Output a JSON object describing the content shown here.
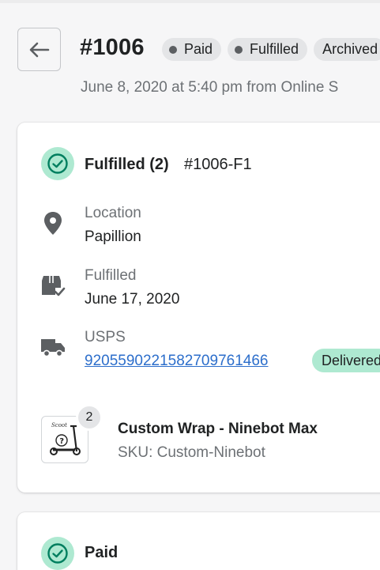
{
  "header": {
    "order_number": "#1006",
    "badges": [
      {
        "label": "Paid",
        "dot": true
      },
      {
        "label": "Fulfilled",
        "dot": true
      },
      {
        "label": "Archived",
        "dot": false
      }
    ],
    "subline": "June 8, 2020 at 5:40 pm from Online S"
  },
  "fulfillment": {
    "title": "Fulfilled (2)",
    "reference": "#1006-F1",
    "location_label": "Location",
    "location_value": "Papillion",
    "fulfilled_label": "Fulfilled",
    "fulfilled_value": "June 17, 2020",
    "carrier_label": "USPS",
    "tracking_number": "9205590221582709761466",
    "tracking_status": "Delivered",
    "item": {
      "quantity": "2",
      "name": "Custom Wrap - Ninebot Max",
      "sku": "SKU: Custom-Ninebot"
    }
  },
  "payment": {
    "title": "Paid"
  },
  "colors": {
    "accent_green": "#aee9d1",
    "check_green": "#007f5f",
    "link_blue": "#2c6ecb",
    "badge_gray": "#e4e5e7"
  }
}
